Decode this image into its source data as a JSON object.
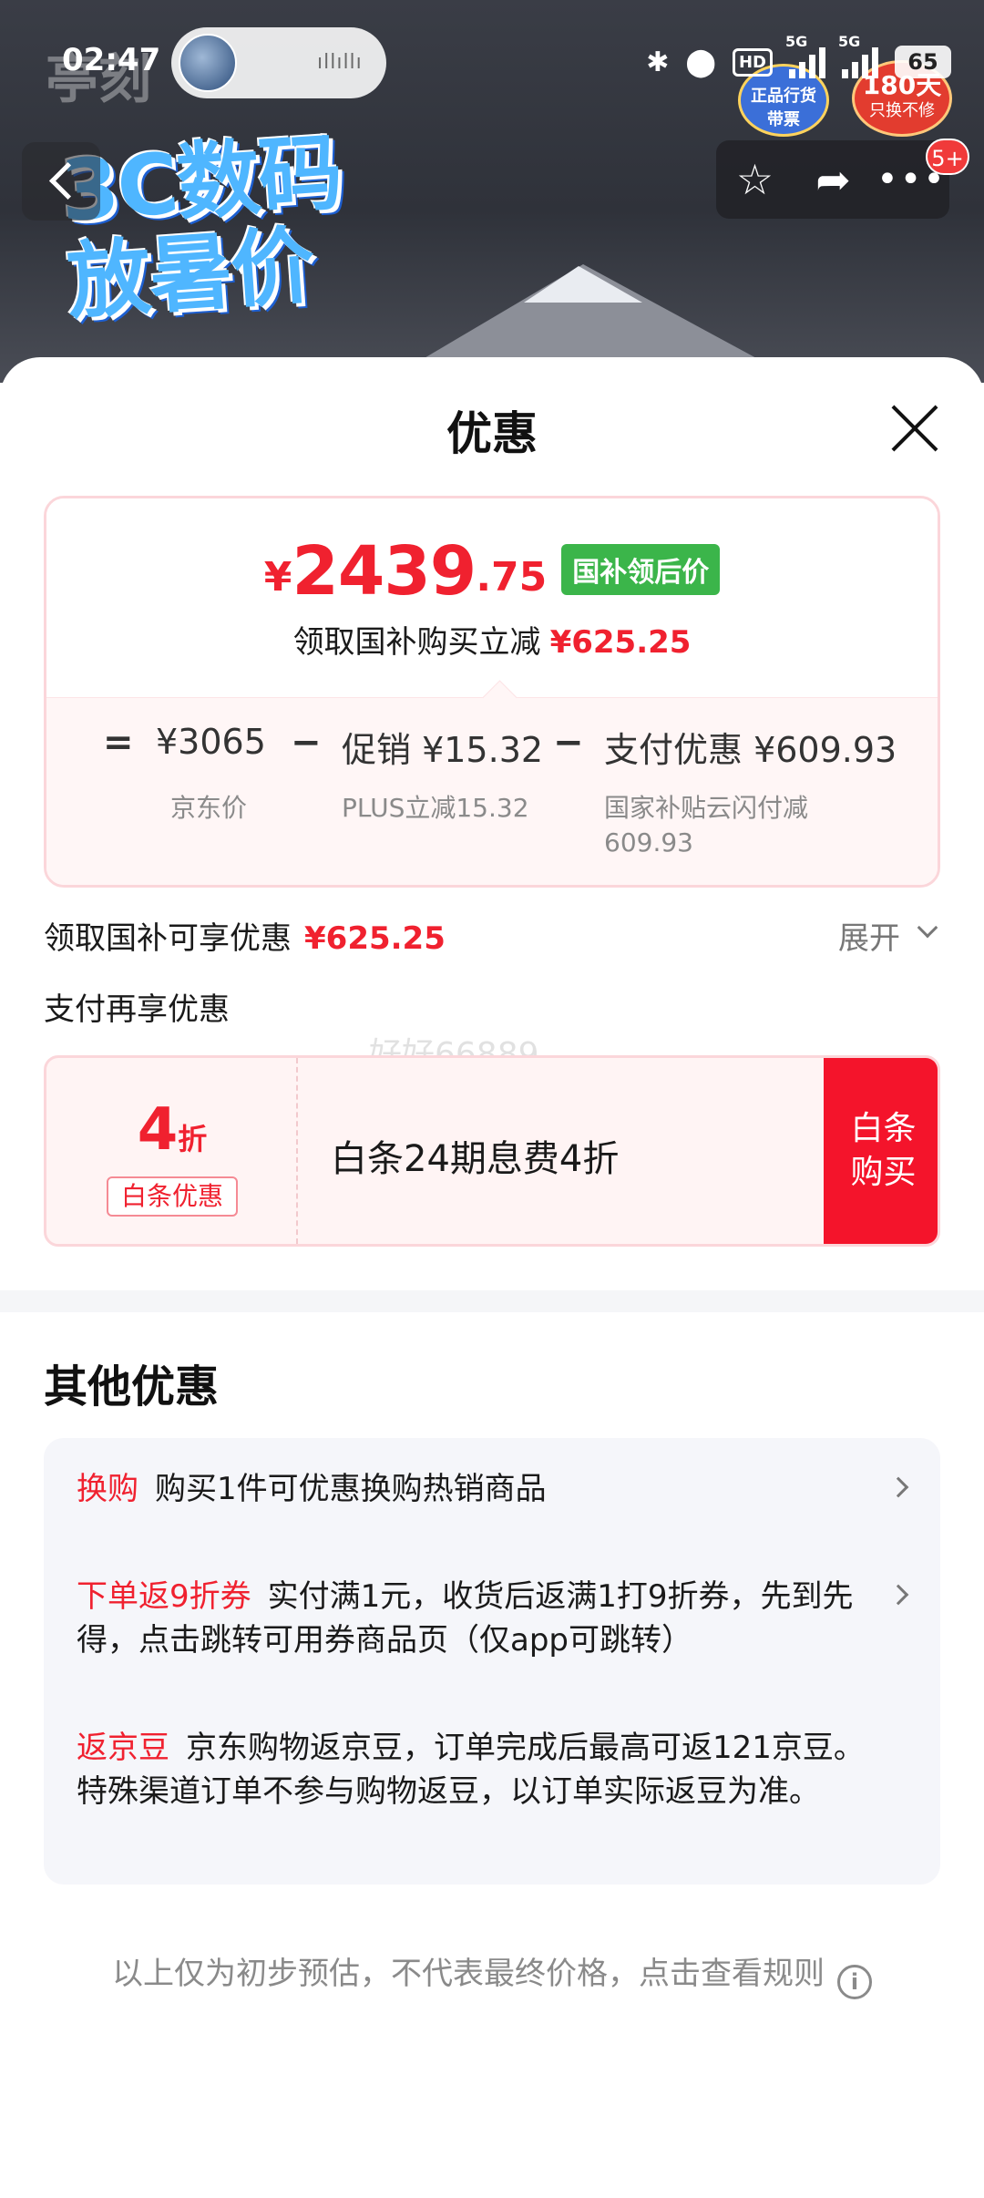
{
  "status_bar": {
    "time": "02:47",
    "signal_label_1": "5G",
    "signal_label_2": "5G",
    "battery": "65",
    "icons": [
      "bluetooth-icon",
      "location-icon",
      "hd-icon",
      "signal-icon",
      "signal-icon",
      "battery-icon"
    ]
  },
  "banner": {
    "faded_logo": "亭刻",
    "promo_title_line1": "3C数码",
    "promo_title_line2": "放暑价",
    "badge_genuine_line1": "正品行货",
    "badge_genuine_line2": "带票",
    "badge_180_big": "180天",
    "badge_180_small": "只换不修",
    "notif_count": "5+"
  },
  "sheet": {
    "title": "优惠",
    "price": {
      "currency": "¥",
      "integer": "2439",
      "decimal": ".75",
      "tag": "国补领后价",
      "save_label": "领取国补购买立减",
      "save_amount": "¥625.25"
    },
    "calc": {
      "eq": "=",
      "minus": "−",
      "jd_price": "¥3065",
      "jd_price_label": "京东价",
      "promo_value": "促销 ¥15.32",
      "promo_sub": "PLUS立减15.32",
      "pay_value": "支付优惠 ¥609.93",
      "pay_sub_line1": "国家补贴云闪付减",
      "pay_sub_line2": "609.93"
    },
    "subsidy_row": {
      "label": "领取国补可享优惠",
      "amount": "¥625.25",
      "expand": "展开"
    },
    "pay_more_label": "支付再享优惠",
    "watermark": "好好66889",
    "baitiao": {
      "discount_num": "4",
      "discount_unit": "折",
      "tag": "白条优惠",
      "desc": "白条24期息费4折",
      "buy_line1": "白条",
      "buy_line2": "购买"
    },
    "other": {
      "title": "其他优惠",
      "offers": [
        {
          "key": "换购",
          "text": "购买1件可优惠换购热销商品"
        },
        {
          "key": "下单返9折券",
          "text": "实付满1元，收货后返满1打9折券，先到先得，点击跳转可用券商品页（仅app可跳转）"
        },
        {
          "key": "返京豆",
          "text": "京东购物返京豆，订单完成后最高可返121京豆。特殊渠道订单不参与购物返豆，以订单实际返豆为准。"
        }
      ]
    },
    "footer": "以上仅为初步预估，不代表最终价格，点击查看规则",
    "footer_icon": "i"
  },
  "colors": {
    "accent_red": "#f0212f",
    "tag_green": "#3bb54a",
    "buy_red": "#f4142b"
  }
}
